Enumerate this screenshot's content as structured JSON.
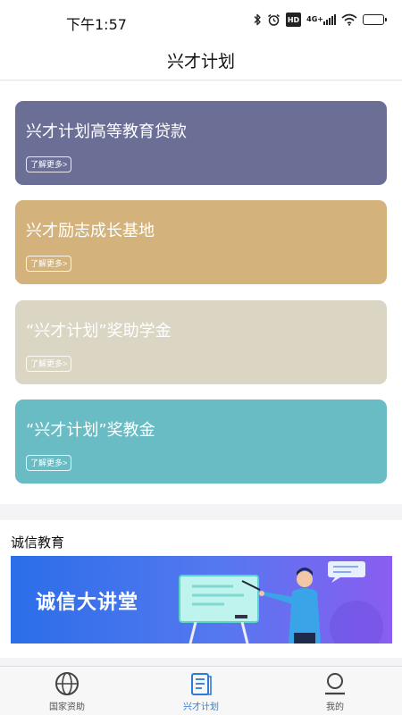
{
  "status_bar": {
    "time": "下午1:57",
    "hd_label": "HD",
    "network_label": "4G+",
    "battery_level": 0.8,
    "icons": [
      "bluetooth-icon",
      "alarm-icon",
      "hd-icon",
      "signal-icon",
      "wifi-icon",
      "battery-icon"
    ]
  },
  "header": {
    "title": "兴才计划"
  },
  "cards": [
    {
      "title": "兴才计划高等教育贷款",
      "button": "了解更多>",
      "color": "#6b6f96"
    },
    {
      "title": "兴才励志成长基地",
      "button": "了解更多>",
      "color": "#d3b37b"
    },
    {
      "title": "“兴才计划”奖助学金",
      "button": "了解更多>",
      "color": "#dbd6c3"
    },
    {
      "title": "“兴才计划”奖教金",
      "button": "了解更多>",
      "color": "#69bcc4"
    }
  ],
  "integrity": {
    "title": "诚信教育",
    "banner_text": "诚信大讲堂"
  },
  "tabbar": {
    "items": [
      {
        "label": "国家资助",
        "icon": "globe-icon",
        "active": false
      },
      {
        "label": "兴才计划",
        "icon": "document-icon",
        "active": true
      },
      {
        "label": "我的",
        "icon": "user-icon",
        "active": false
      }
    ],
    "active_color": "#2e7bd6"
  }
}
